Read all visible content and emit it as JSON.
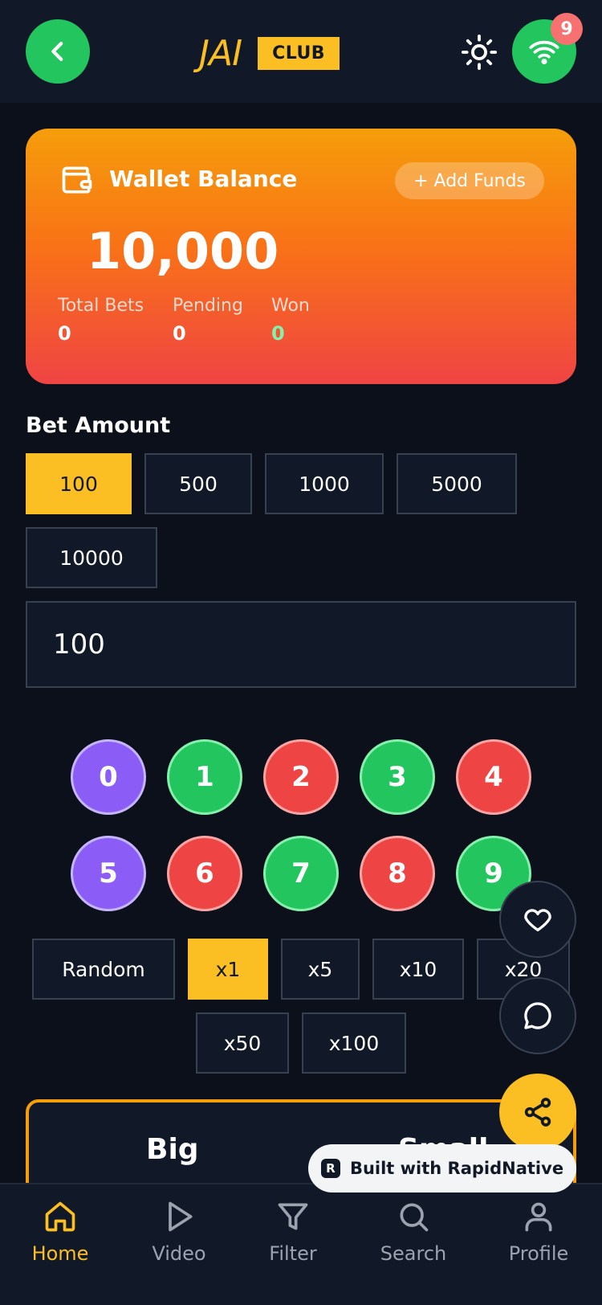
{
  "header": {
    "logo_main": "JAI",
    "logo_badge": "CLUB",
    "notification_count": "9",
    "icons": [
      "chevron-left-icon",
      "sun-icon",
      "wifi-icon"
    ]
  },
  "wallet": {
    "title": "Wallet Balance",
    "add_funds_label": "+ Add Funds",
    "balance": "10,000",
    "stats": [
      {
        "label": "Total Bets",
        "value": "0"
      },
      {
        "label": "Pending",
        "value": "0"
      },
      {
        "label": "Won",
        "value": "0"
      }
    ],
    "won_color": "#86efac"
  },
  "bet": {
    "label": "Bet Amount",
    "chips": [
      "100",
      "500",
      "1000",
      "5000",
      "10000"
    ],
    "selected_chip": "100",
    "input_value": "100"
  },
  "numbers": [
    {
      "value": "0",
      "color": "purple"
    },
    {
      "value": "1",
      "color": "green"
    },
    {
      "value": "2",
      "color": "red"
    },
    {
      "value": "3",
      "color": "green"
    },
    {
      "value": "4",
      "color": "red"
    },
    {
      "value": "5",
      "color": "purple"
    },
    {
      "value": "6",
      "color": "red"
    },
    {
      "value": "7",
      "color": "green"
    },
    {
      "value": "8",
      "color": "red"
    },
    {
      "value": "9",
      "color": "green"
    }
  ],
  "multipliers": {
    "random_label": "Random",
    "options": [
      "x1",
      "x5",
      "x10",
      "x20",
      "x50",
      "x100"
    ],
    "selected": "x1"
  },
  "bigsmall": {
    "big_label": "Big",
    "small_label": "Small"
  },
  "floating": {
    "icons": [
      "heart-icon",
      "chat-icon",
      "share-icon"
    ]
  },
  "built_with": "Built with RapidNative",
  "nav": {
    "items": [
      {
        "label": "Home",
        "icon": "home-icon"
      },
      {
        "label": "Video",
        "icon": "play-icon"
      },
      {
        "label": "Filter",
        "icon": "filter-icon"
      },
      {
        "label": "Search",
        "icon": "search-icon"
      },
      {
        "label": "Profile",
        "icon": "profile-icon"
      }
    ],
    "active": "Home"
  },
  "colors": {
    "accent": "#fbbf24",
    "success": "#22c55e",
    "danger": "#ef4444",
    "purple": "#8b5cf6",
    "background": "#0b101b",
    "surface": "#111827"
  }
}
